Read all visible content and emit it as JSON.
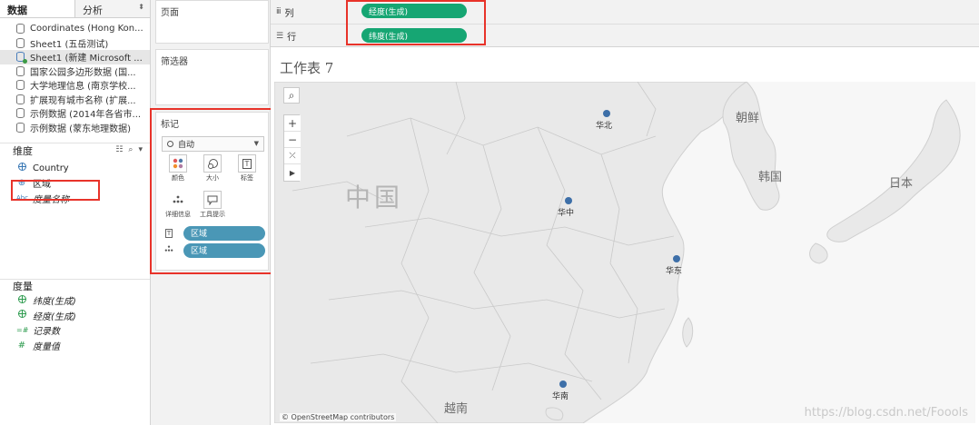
{
  "data_pane": {
    "tab_data": "数据",
    "tab_analysis": "分析",
    "sort_icon": "sort-arrows-icon",
    "datasources": [
      {
        "label": "Coordinates (Hong Kon..."
      },
      {
        "label": "Sheet1 (五岳测试)"
      },
      {
        "label": "Sheet1 (新建 Microsoft ..."
      },
      {
        "label": "国家公园多边形数据 (国..."
      },
      {
        "label": "大学地理信息 (南京学校..."
      },
      {
        "label": "扩展现有城市名称 (扩展..."
      },
      {
        "label": "示例数据 (2014年各省市..."
      },
      {
        "label": "示例数据 (蒙东地理数据)"
      }
    ],
    "dimensions_header": "维度",
    "dimensions": [
      {
        "label": "Country",
        "icon": "globe-icon"
      },
      {
        "label": "区域",
        "icon": "geo-group-icon"
      },
      {
        "label": "度量名称",
        "icon": "abc-icon",
        "icon_text": "Abc"
      }
    ],
    "measures_header": "度量",
    "measures": [
      {
        "label": "纬度(生成)",
        "icon": "globe-icon"
      },
      {
        "label": "经度(生成)",
        "icon": "globe-icon"
      },
      {
        "label": "记录数",
        "icon": "number-icon",
        "icon_text": "=#"
      },
      {
        "label": "度量值",
        "icon": "number-icon",
        "icon_text": "#"
      }
    ]
  },
  "shelves": {
    "pages_title": "页面",
    "filters_title": "筛选器",
    "marks": {
      "title": "标记",
      "mark_type": "自动",
      "buttons": [
        {
          "label": "颜色",
          "icon": "color-dots-icon"
        },
        {
          "label": "大小",
          "icon": "size-icon"
        },
        {
          "label": "标签",
          "icon": "text-label-icon",
          "icon_text": "T"
        },
        {
          "label": "详细信息",
          "icon": "detail-icon"
        },
        {
          "label": "工具提示",
          "icon": "tooltip-icon"
        }
      ],
      "pills": [
        {
          "label": "区域",
          "icon": "text-label-icon"
        },
        {
          "label": "区域",
          "icon": "detail-icon"
        }
      ]
    },
    "columns_label": "列",
    "columns_pill": "经度(生成)",
    "rows_label": "行",
    "rows_pill": "纬度(生成)"
  },
  "sheet": {
    "title": "工作表 7",
    "map": {
      "labels": {
        "china": "中国",
        "korea_north": "朝鲜",
        "korea_south": "韩国",
        "japan": "日本",
        "vietnam": "越南"
      },
      "points": [
        {
          "label": "华北"
        },
        {
          "label": "华中"
        },
        {
          "label": "华东"
        },
        {
          "label": "华南"
        }
      ],
      "attribution": "© OpenStreetMap contributors",
      "watermark": "https://blog.csdn.net/Foools"
    }
  },
  "colors": {
    "green_pill": "#16a673",
    "blue_pill": "#4a97b6",
    "highlight": "#e8332a",
    "map_point": "#3d6fa8"
  }
}
